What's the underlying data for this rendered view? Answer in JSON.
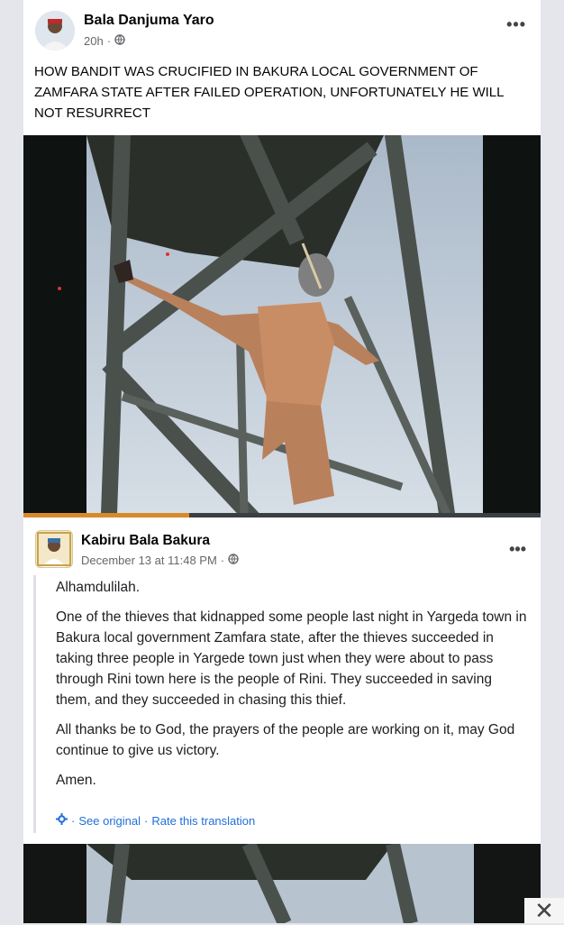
{
  "post": {
    "author": "Bala Danjuma Yaro",
    "time": "20h",
    "audience_icon": "globe-icon",
    "more_label": "•••",
    "text": "HOW BANDIT WAS CRUCIFIED IN BAKURA LOCAL GOVERNMENT OF ZAMFARA STATE AFTER FAILED OPERATION, UNFORTUNATELY HE WILL NOT RESURRECT",
    "video_progress": 0.32
  },
  "shared": {
    "author": "Kabiru Bala Bakura",
    "time": "December 13 at 11:48 PM",
    "separator": "·",
    "audience_icon": "globe-icon",
    "more_label": "•••",
    "paragraphs": [
      "Alhamdulilah.",
      "One of the thieves that kidnapped some people last night in Yargeda town in Bakura local government Zamfara state, after the thieves succeeded in taking three people in Yargede town just when they were about to pass through Rini town here is the people of Rini. They succeeded in saving them, and they succeeded in chasing this thief.",
      "All thanks be to God, the prayers of the people are working on it, may God continue to give us victory.",
      "Amen."
    ],
    "see_original": "See original",
    "rate_translation": "Rate this translation",
    "dot": "·"
  },
  "close_label": "✕",
  "colors": {
    "link": "#216fdb",
    "meta": "#65676b",
    "progress": "#d88a2a"
  }
}
